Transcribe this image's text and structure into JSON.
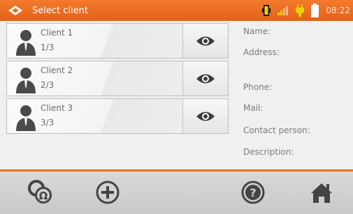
{
  "header": {
    "title": "Select client",
    "time": "08:22"
  },
  "clients": [
    {
      "name": "Client 1",
      "count": "1/3"
    },
    {
      "name": "Client 2",
      "count": "2/3"
    },
    {
      "name": "Client 3",
      "count": "3/3"
    }
  ],
  "details": {
    "name_label": "Name:",
    "address_label": "Address:",
    "phone_label": "Phone:",
    "mail_label": "Mail:",
    "contact_label": "Contact person:",
    "description_label": "Description:"
  },
  "icons": {
    "logo": "meter-logo-icon",
    "battery_status": "battery-status-icon",
    "signal": "signal-icon",
    "plug": "plug-icon",
    "battery": "battery-icon",
    "client": "person-icon",
    "view": "eye-icon",
    "search": "search-meter-icon",
    "add": "plus-icon",
    "help": "help-icon",
    "home": "home-icon"
  },
  "colors": {
    "accent": "#e8731f",
    "header": "#ee6f22"
  }
}
